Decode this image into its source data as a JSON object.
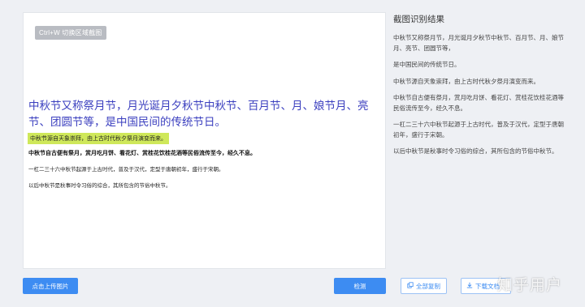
{
  "preview": {
    "area_tag": "Ctrl+W 切换区域截图",
    "heading": "中秋节又称祭月节，月光诞月夕秋节中秋节、百月节、月、娘节月、亮节、团圆节等，是中国民间的传统节日。",
    "highlight_line": "中秋节源自天象崇拜，由上古时代秋夕祭月演变而来。",
    "bold_line": "中秋节自古便有祭月，赏月吃月饼、看花灯、赏桂花饮桂花酒等民俗流传至今，经久不息。",
    "small_line_1": "一杠二三十六中秋节起源于上古时代，普及于汉代，定型于唐朝初年，盛行于宋朝。",
    "small_line_2": "以后中秋节是秋事时令习俗的综合，其所包含的节俗中秋节。"
  },
  "result": {
    "title": "截图识别结果",
    "paragraphs": [
      "中秋节又称祭月节，月光诞月夕秋节中秋节、百月节、月、娘节月、亮节、团圆节等，",
      "是中国民间的传统节日。",
      "中秋节源自天象崇拜，由上古时代秋夕祭月演变而来。",
      "中秋节自古便有祭月，赏月吃月饼、看花灯、赏桂花饮桂花酒等民俗流传至今，经久不息。",
      "一杠二三十六中秋节起源于上古时代，普及于汉代，定型于唐朝初年，盛行于宋朝。",
      "以后中秋节是秋事时令习俗的综合，其所包含的节俗中秋节。"
    ]
  },
  "buttons": {
    "upload": "点击上传图片",
    "recognize": "检测",
    "copy_all": "全部复制",
    "download": "下载文档"
  },
  "watermark": "知乎用户",
  "colors": {
    "accent": "#3d8cf2",
    "heading_text": "#3b3fbf",
    "highlight": "#cfe85a"
  }
}
